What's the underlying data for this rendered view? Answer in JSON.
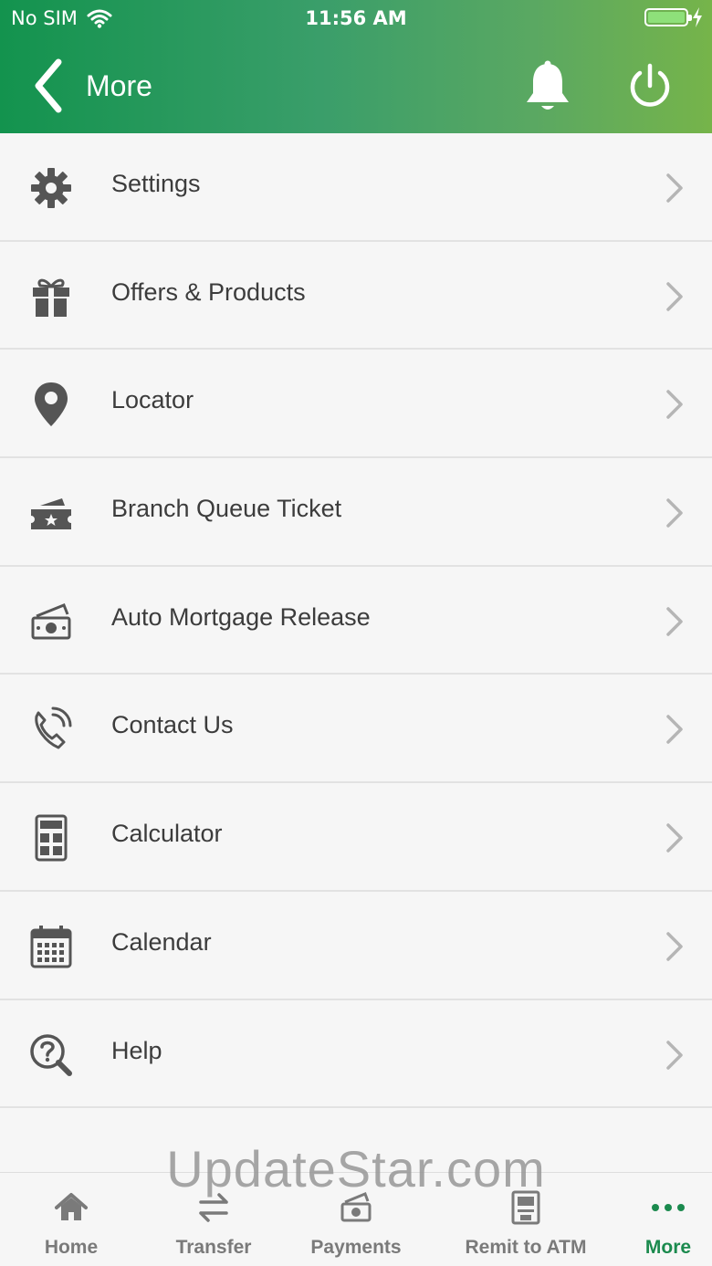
{
  "status": {
    "carrier": "No SIM",
    "time": "11:56 AM"
  },
  "header": {
    "title": "More"
  },
  "menu": [
    {
      "label": "Settings",
      "icon": "gear-icon"
    },
    {
      "label": "Offers & Products",
      "icon": "gift-icon"
    },
    {
      "label": "Locator",
      "icon": "location-pin-icon"
    },
    {
      "label": "Branch Queue Ticket",
      "icon": "ticket-icon"
    },
    {
      "label": "Auto Mortgage Release",
      "icon": "money-icon"
    },
    {
      "label": "Contact Us",
      "icon": "phone-icon"
    },
    {
      "label": "Calculator",
      "icon": "calculator-icon"
    },
    {
      "label": "Calendar",
      "icon": "calendar-icon"
    },
    {
      "label": "Help",
      "icon": "help-icon"
    }
  ],
  "tabs": [
    {
      "label": "Home",
      "icon": "home-icon"
    },
    {
      "label": "Transfer",
      "icon": "transfer-icon"
    },
    {
      "label": "Payments",
      "icon": "payments-icon"
    },
    {
      "label": "Remit to ATM",
      "icon": "atm-icon"
    },
    {
      "label": "More",
      "icon": "more-dots-icon"
    }
  ],
  "active_tab": "More",
  "colors": {
    "brand_green": "#1b8a4e",
    "header_start": "#13934e",
    "header_end": "#76b44a"
  },
  "watermark": "UpdateStar.com"
}
